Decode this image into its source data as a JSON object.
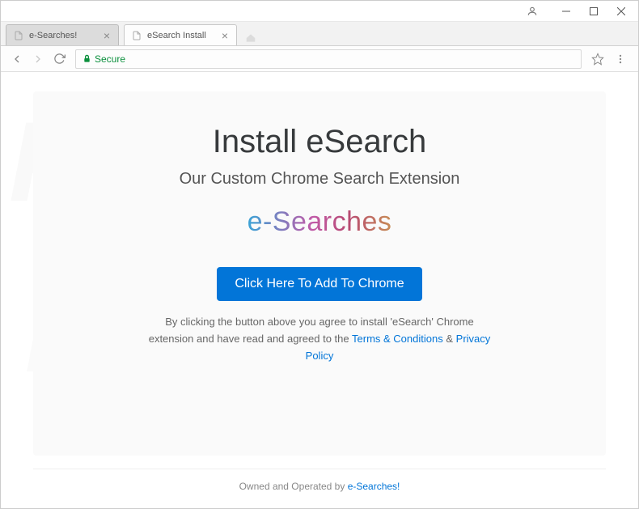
{
  "window": {
    "tabs": [
      {
        "title": "e-Searches!"
      },
      {
        "title": "eSearch Install"
      }
    ]
  },
  "addressbar": {
    "secure_label": "Secure"
  },
  "page": {
    "heading": "Install eSearch",
    "subtitle": "Our Custom Chrome Search Extension",
    "logo_text": "e-Searches",
    "cta_label": "Click Here To Add To Chrome",
    "agree_prefix": "By clicking the button above you agree to install 'eSearch' Chrome extension and have read and agreed to the ",
    "terms_label": "Terms & Conditions",
    "amp": " & ",
    "privacy_label": "Privacy Policy"
  },
  "footer": {
    "prefix": "Owned and Operated by ",
    "link_label": "e-Searches!"
  }
}
